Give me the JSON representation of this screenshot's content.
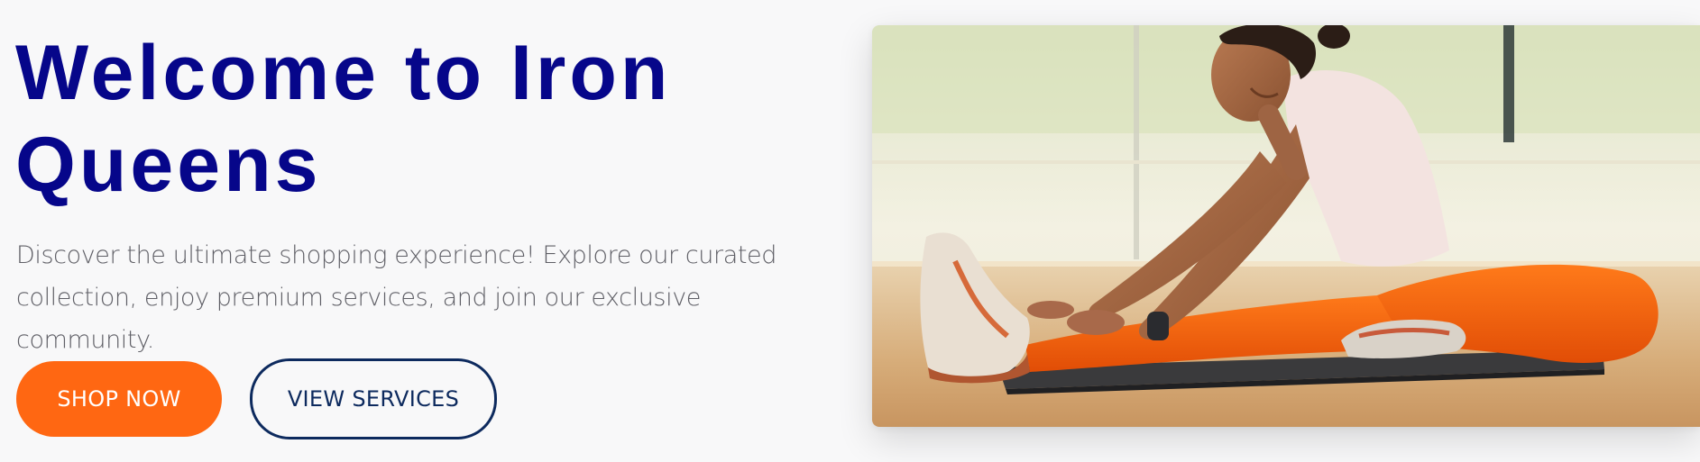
{
  "hero": {
    "title_line1": "Welcome to Iron",
    "title_line2": "Queens",
    "description_line1": "Discover the ultimate shopping experience! Explore our curated",
    "description_line2": "collection, enjoy premium services, and join our exclusive community.",
    "primary_button_label": "SHOP NOW",
    "secondary_button_label": "VIEW SERVICES",
    "image_subject": "woman stretching on yoga mat"
  },
  "colors": {
    "title": "#06068a",
    "primary_button": "#ff6712",
    "secondary_button_border": "#0d2a5e",
    "description": "#5f5f66"
  }
}
